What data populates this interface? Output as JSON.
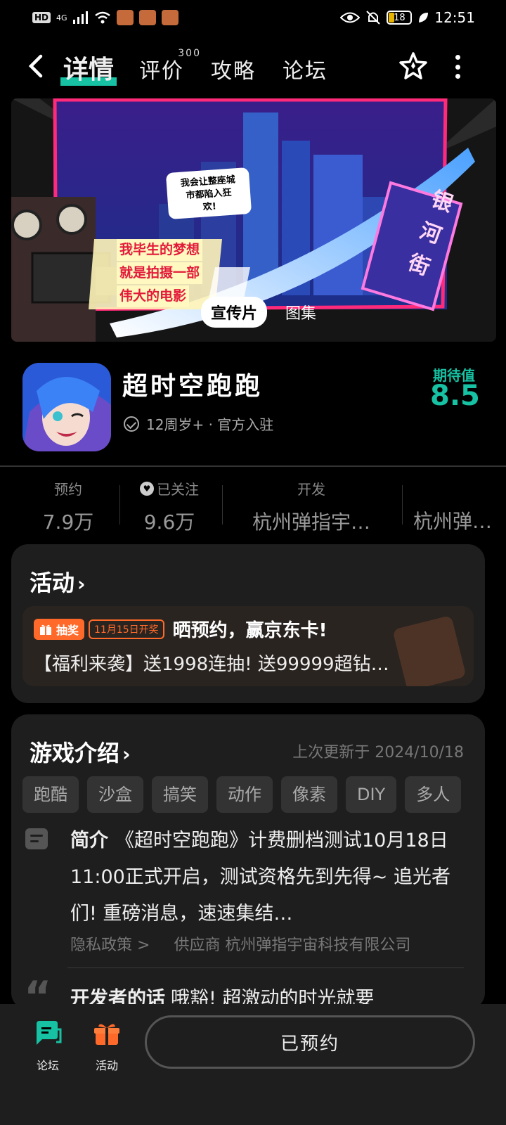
{
  "status_bar": {
    "hd": "HD",
    "network": "4G",
    "battery": "18",
    "time": "12:51"
  },
  "nav": {
    "back_icon": "chevron-left-icon",
    "tabs": [
      {
        "label": "详情",
        "active": true
      },
      {
        "label": "评价",
        "count": "300"
      },
      {
        "label": "攻略"
      },
      {
        "label": "论坛"
      }
    ],
    "star_icon": "star-icon",
    "more_icon": "more-vertical-icon"
  },
  "banner": {
    "tabs": [
      "宣传片",
      "图集"
    ],
    "speech": [
      "我会让整座城",
      "市都陷入狂",
      "欢!"
    ],
    "quote": [
      "我毕生的梦想",
      "就是拍摄一部",
      "伟大的电影"
    ],
    "sign": [
      "银",
      "河",
      "街"
    ]
  },
  "game": {
    "title": "超时空跑跑",
    "meta": "12周岁+ · 官方入驻",
    "expect_label": "期待值",
    "expect_score": "8.5"
  },
  "stats": [
    {
      "label": "预约",
      "value": "7.9万"
    },
    {
      "label": "已关注",
      "value": "9.6万"
    },
    {
      "label": "开发",
      "value": "杭州弹指宇…"
    },
    {
      "label": "",
      "value": "杭州弹…"
    }
  ],
  "activity": {
    "title": "活动",
    "badge": "抽奖",
    "date": "11月15日开奖",
    "headline": "晒预约，赢京东卡!",
    "desc": "【福利来袭】送1998连抽! 送99999超钻…"
  },
  "intro": {
    "title": "游戏介绍",
    "updated": "上次更新于 2024/10/18",
    "tags": [
      "跑酷",
      "沙盒",
      "搞笑",
      "动作",
      "像素",
      "DIY",
      "多人"
    ],
    "summary_label": "简介",
    "summary": "《超时空跑跑》计费删档测试10月18日11:00正式开启，测试资格先到先得~ 追光者们! 重磅消息，速速集结…",
    "privacy": "隐私政策 >",
    "supplier": "供应商 杭州弹指宇宙科技有限公司",
    "dev_label": "开发者的话",
    "dev_text": "哦豁! 超激动的时光就要"
  },
  "bottom": {
    "forum_label": "论坛",
    "activity_label": "活动",
    "reserve_label": "已预约"
  }
}
